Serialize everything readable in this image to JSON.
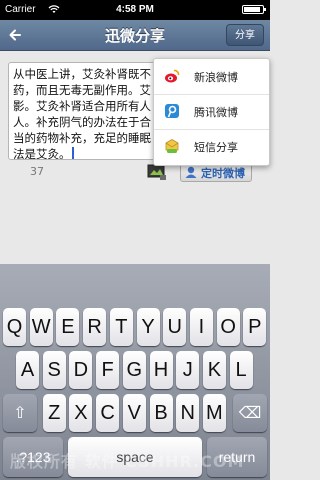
{
  "status": {
    "carrier": "Carrier",
    "time": "4:58 PM",
    "battery_level": 0.9
  },
  "nav": {
    "title": "迅微分享",
    "share_label": "分享"
  },
  "editor": {
    "lines": [
      "从中医上讲，艾灸补肾既不",
      "药，而且无毒无副作用。艾",
      "影。艾灸补肾适合用所有人",
      "人。补充阴气的办法在于合",
      "当的药物补充，充足的睡眠",
      "法是艾灸。"
    ]
  },
  "char_count": "37",
  "timed_button": {
    "label": "定时微博"
  },
  "popup": {
    "items": [
      {
        "label": "新浪微博",
        "icon": "sina-weibo-icon"
      },
      {
        "label": "腾讯微博",
        "icon": "tencent-weibo-icon"
      },
      {
        "label": "短信分享",
        "icon": "sms-icon"
      }
    ]
  },
  "keyboard": {
    "row1": [
      "Q",
      "W",
      "E",
      "R",
      "T",
      "Y",
      "U",
      "I",
      "O",
      "P"
    ],
    "row2": [
      "A",
      "S",
      "D",
      "F",
      "G",
      "H",
      "J",
      "K",
      "L"
    ],
    "row3": [
      "Z",
      "X",
      "C",
      "V",
      "B",
      "N",
      "M"
    ],
    "shift": "⇧",
    "delete": "⌫",
    "numbers": ".?123",
    "space": "space",
    "return": "return"
  },
  "watermark": "版权所有 软件 CSHHR.COM"
}
